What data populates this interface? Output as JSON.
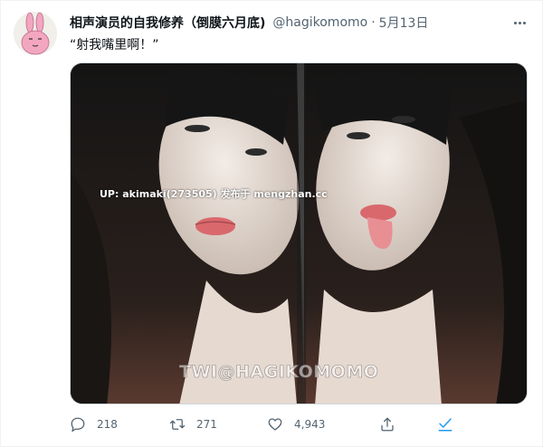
{
  "colors": {
    "text_primary": "#0f1419",
    "text_secondary": "#536471",
    "accent": "#1d9bf0",
    "avatar_bunny": "#f3a6c0"
  },
  "tweet": {
    "display_name": "相声演员的自我修养（倒膜六月底)",
    "handle": "@hagikomomo",
    "separator": "·",
    "date": "5月13日",
    "text": "“射我嘴里啊！”",
    "media": {
      "watermark_top": "UP: akimaki(273505) 发布于 mengzhan.cc",
      "watermark_bottom": "TWI@HAGIKOMOMO"
    },
    "actions": {
      "reply_count": "218",
      "retweet_count": "271",
      "like_count": "4,943"
    },
    "icons": {
      "more": "more-horizontal-icon",
      "reply": "reply-icon",
      "retweet": "retweet-icon",
      "like": "heart-icon",
      "share": "share-icon",
      "check": "checkmark-icon"
    }
  }
}
